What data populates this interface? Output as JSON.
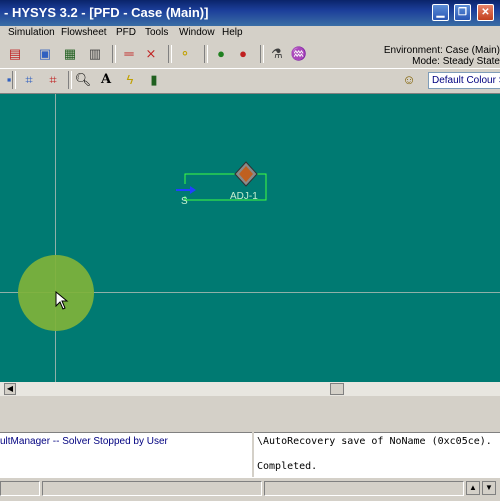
{
  "window": {
    "title": "- HYSYS 3.2 - [PFD - Case (Main)]"
  },
  "menu": {
    "items": [
      "Simulation",
      "Flowsheet",
      "PFD",
      "Tools",
      "Window",
      "Help"
    ]
  },
  "environment": {
    "environment_line": "Environment: Case (Main)",
    "mode_line": "Mode: Steady State"
  },
  "toolbar2": {
    "colour_scheme": "Default Colour S"
  },
  "pfd": {
    "operation_label": "ADJ-1",
    "stream_label": "S"
  },
  "trace": {
    "left_line": "ultManager -- Solver Stopped by User",
    "right_line1": "\\AutoRecovery save of NoName (0xc05ce).",
    "right_line2": "Completed."
  },
  "colors": {
    "canvas": "#007a72",
    "titlebar": "#0a246a",
    "cursor_highlight": "#7fb23a"
  }
}
